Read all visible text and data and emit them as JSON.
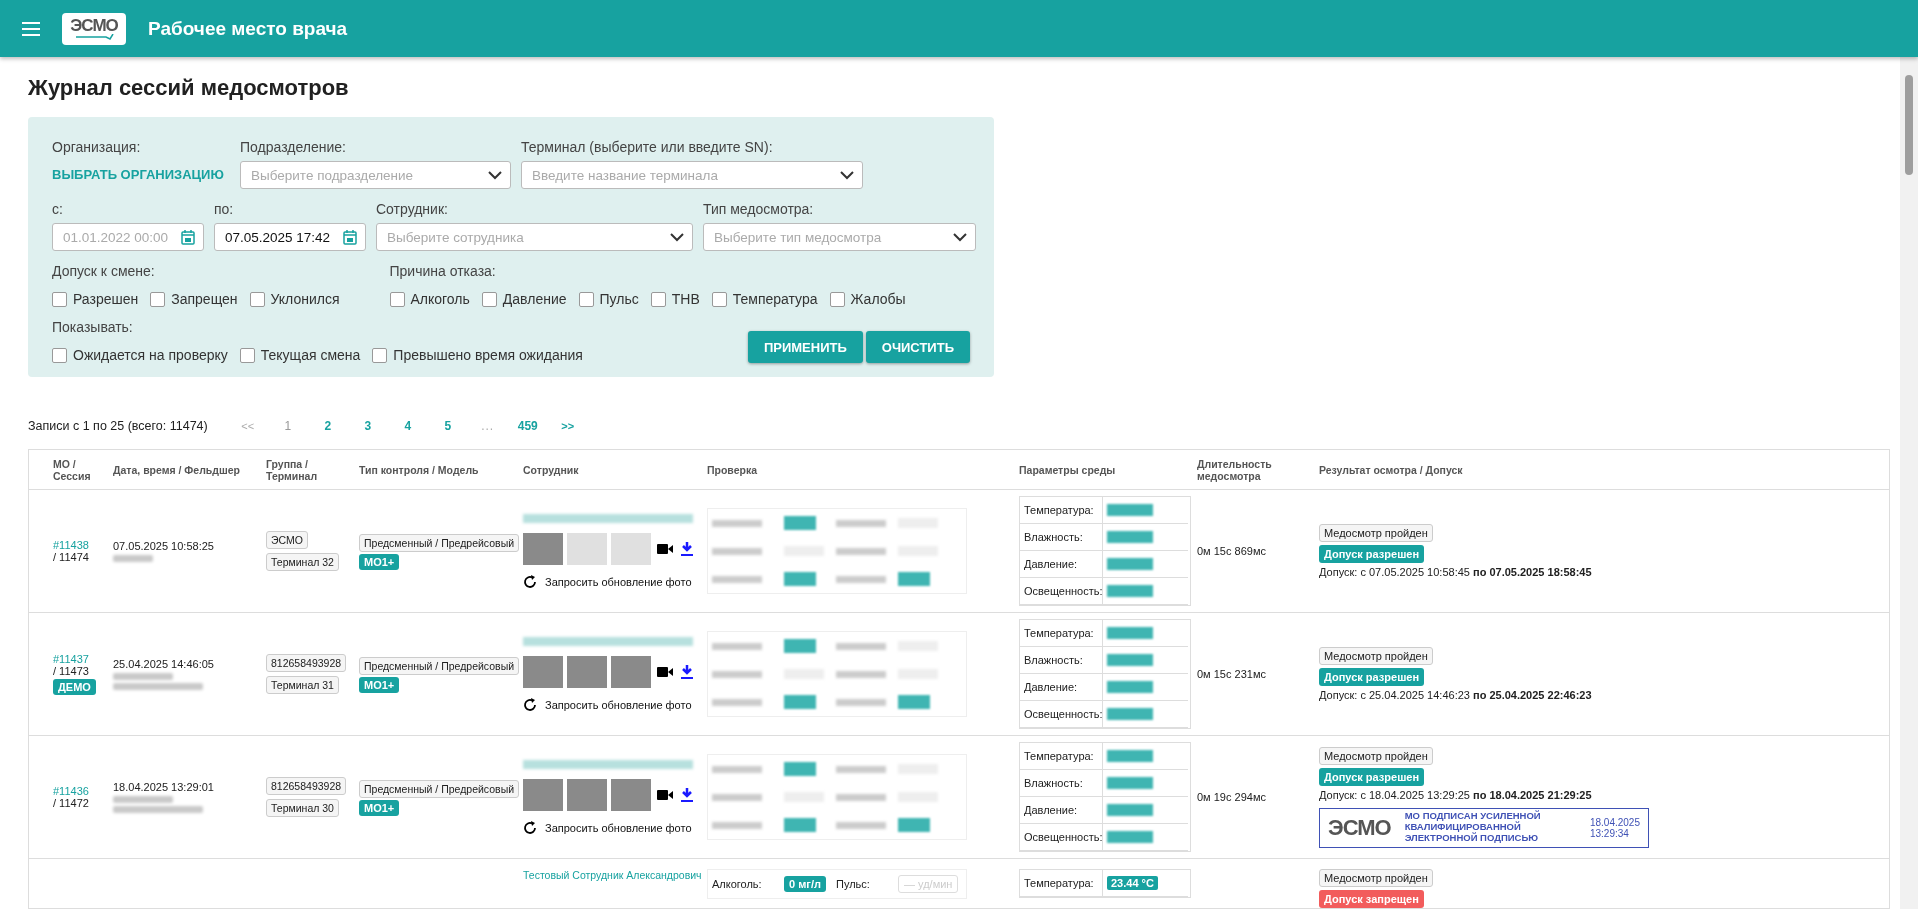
{
  "header": {
    "logo": "ЭСМО",
    "title": "Рабочее место врача"
  },
  "page_title": "Журнал сессий медосмотров",
  "filters": {
    "organization": {
      "label": "Организация:",
      "link": "ВЫБРАТЬ ОРГАНИЗАЦИЮ"
    },
    "selects": [
      {
        "label": "Подразделение:",
        "placeholder": "Выберите подразделение"
      },
      {
        "label": "Терминал (выберите или введите SN):",
        "placeholder": "Введите название терминала"
      }
    ],
    "date_from": {
      "label": "с:",
      "placeholder": "01.01.2022 00:00"
    },
    "date_to": {
      "label": "по:",
      "value": "07.05.2025 17:42"
    },
    "selects2": [
      {
        "label": "Сотрудник:",
        "placeholder": "Выберите сотрудника"
      },
      {
        "label": "Тип медосмотра:",
        "placeholder": "Выберите тип медосмотра"
      }
    ],
    "groups": [
      {
        "label": "Допуск к смене:",
        "options": [
          {
            "label": "Разрешен",
            "checked": false
          },
          {
            "label": "Запрещен",
            "checked": false
          },
          {
            "label": "Уклонился",
            "checked": false
          }
        ]
      },
      {
        "label": "Причина отказа:",
        "options": [
          {
            "label": "Алкоголь",
            "checked": false
          },
          {
            "label": "Давление",
            "checked": false
          },
          {
            "label": "Пульс",
            "checked": false
          },
          {
            "label": "ТНВ",
            "checked": false
          },
          {
            "label": "Температура",
            "checked": false
          },
          {
            "label": "Жалобы",
            "checked": false
          }
        ]
      }
    ],
    "show": {
      "label": "Показывать:",
      "options": [
        {
          "label": "Ожидается на проверку",
          "checked": false
        },
        {
          "label": "Текущая смена",
          "checked": false
        },
        {
          "label": "Превышено время ожидания",
          "checked": false
        }
      ]
    },
    "buttons": [
      "ПРИМЕНИТЬ",
      "ОЧИСТИТЬ"
    ]
  },
  "pagination": {
    "summary": "Записи с 1 по 25 (всего: 11474)",
    "pages": [
      {
        "label": "<<",
        "kind": "nav",
        "selected": false,
        "disabled": true
      },
      {
        "label": "1",
        "kind": "page",
        "selected": true,
        "disabled": false
      },
      {
        "label": "2",
        "kind": "page",
        "selected": false,
        "disabled": false
      },
      {
        "label": "3",
        "kind": "page",
        "selected": false,
        "disabled": false
      },
      {
        "label": "4",
        "kind": "page",
        "selected": false,
        "disabled": false
      },
      {
        "label": "5",
        "kind": "page",
        "selected": false,
        "disabled": false
      },
      {
        "label": "...",
        "kind": "gap",
        "selected": false,
        "disabled": true
      },
      {
        "label": "459",
        "kind": "page",
        "selected": false,
        "disabled": false
      },
      {
        "label": ">>",
        "kind": "nav",
        "selected": false,
        "disabled": false
      }
    ]
  },
  "table": {
    "columns": [
      "МО / Сессия",
      "Дата, время / Фельдшер",
      "Группа / Терминал",
      "Тип контроля / Модель",
      "Сотрудник",
      "Проверка",
      "Параметры среды",
      "Длительность медосмотра",
      "Результат осмотра / Допуск"
    ],
    "rows": [
      {
        "mo": "#11438",
        "session": "/ 11474",
        "datetime": "07.05.2025 10:58:25",
        "group": "ЭСМО",
        "terminal": "Терминал 32",
        "type": "Предсменный / Предрейсовый",
        "model": "МО1+",
        "refresh": "Запросить обновление фото",
        "env": [
          {
            "label": "Температура:"
          },
          {
            "label": "Влажность:"
          },
          {
            "label": "Давление:"
          },
          {
            "label": "Освещенность:"
          }
        ],
        "duration": "0м 15с 869мс",
        "result": "Медосмотр пройден",
        "admission": {
          "label": "Допуск разрешен",
          "kind": "allowed"
        },
        "period": "Допуск: с 07.05.2025 10:58:45 **по 07.05.2025 18:58:45**"
      },
      {
        "mo": "#11437",
        "session": "/ 11473",
        "badge": "ДЕМО",
        "datetime": "25.04.2025 14:46:05",
        "group": "812658493928",
        "terminal": "Терминал 31",
        "type": "Предсменный / Предрейсовый",
        "model": "МО1+",
        "refresh": "Запросить обновление фото",
        "env": [
          {
            "label": "Температура:"
          },
          {
            "label": "Влажность:"
          },
          {
            "label": "Давление:"
          },
          {
            "label": "Освещенность:"
          }
        ],
        "duration": "0м 15с 231мс",
        "result": "Медосмотр пройден",
        "admission": {
          "label": "Допуск разрешен",
          "kind": "allowed"
        },
        "period": "Допуск: с 25.04.2025 14:46:23 **по 25.04.2025 22:46:23**"
      },
      {
        "mo": "#11436",
        "session": "/ 11472",
        "datetime": "18.04.2025 13:29:01",
        "group": "812658493928",
        "terminal": "Терминал 30",
        "type": "Предсменный / Предрейсовый",
        "model": "МО1+",
        "refresh": "Запросить обновление фото",
        "env": [
          {
            "label": "Температура:"
          },
          {
            "label": "Влажность:"
          },
          {
            "label": "Давление:"
          },
          {
            "label": "Освещенность:"
          }
        ],
        "duration": "0м 19с 294мс",
        "result": "Медосмотр пройден",
        "admission": {
          "label": "Допуск разрешен",
          "kind": "allowed"
        },
        "period": "Допуск: с 18.04.2025 13:29:25 **по 18.04.2025 21:29:25**",
        "signature": {
          "logo": "ЭСМО",
          "text": "МО ПОДПИСАН УСИЛЕННОЙ КВАЛИФИЦИРОВАННОЙ ЭЛЕКТРОННОЙ ПОДПИСЬЮ",
          "date": "18.04.2025",
          "time": "13:29:34"
        }
      },
      {
        "employee": "Тестовый Сотрудник Александрович",
        "checks": [
          {
            "label": "Алкоголь:",
            "value": "0 мг/л",
            "kind": "ok"
          },
          {
            "label": "Пульс:",
            "value": "— уд/мин",
            "kind": "empty"
          }
        ],
        "env": [
          {
            "label": "Температура:",
            "value": "23.44 °C"
          }
        ],
        "result": "Медосмотр пройден",
        "admission": {
          "label": "Допуск запрещен",
          "kind": "denied"
        }
      }
    ]
  }
}
